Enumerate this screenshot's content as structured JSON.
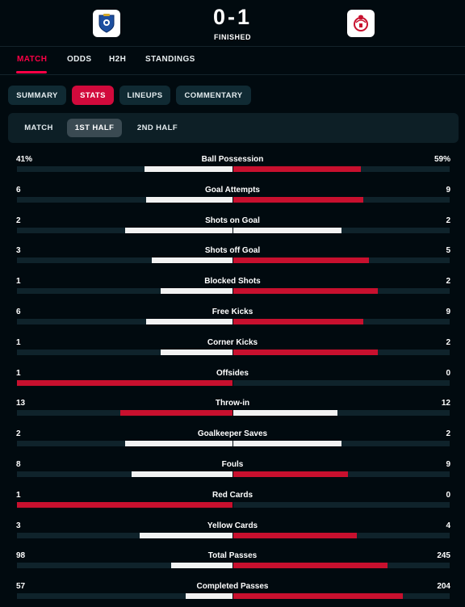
{
  "match": {
    "score": "0-1",
    "status": "FINISHED",
    "home_team_icon": "porto-crest-icon",
    "away_team_icon": "benfica-crest-icon"
  },
  "top_nav": [
    "MATCH",
    "ODDS",
    "H2H",
    "STANDINGS"
  ],
  "sub_tabs": [
    "SUMMARY",
    "STATS",
    "LINEUPS",
    "COMMENTARY"
  ],
  "periods": [
    "MATCH",
    "1ST HALF",
    "2ND HALF"
  ],
  "colors": {
    "accent": "#ff0046",
    "active_pill": "#d20a3c",
    "home_bar": "#f2f2f2",
    "away_bar": "#c8102e",
    "background": "#010a0f"
  },
  "stats": [
    {
      "label": "Ball Possession",
      "home": "41%",
      "away": "59%",
      "home_share": 0.41,
      "away_share": 0.59
    },
    {
      "label": "Goal Attempts",
      "home": "6",
      "away": "9",
      "home_share": 0.4,
      "away_share": 0.6
    },
    {
      "label": "Shots on Goal",
      "home": "2",
      "away": "2",
      "home_share": 0.5,
      "away_share": 0.5
    },
    {
      "label": "Shots off Goal",
      "home": "3",
      "away": "5",
      "home_share": 0.375,
      "away_share": 0.625
    },
    {
      "label": "Blocked Shots",
      "home": "1",
      "away": "2",
      "home_share": 0.333,
      "away_share": 0.667
    },
    {
      "label": "Free Kicks",
      "home": "6",
      "away": "9",
      "home_share": 0.4,
      "away_share": 0.6
    },
    {
      "label": "Corner Kicks",
      "home": "1",
      "away": "2",
      "home_share": 0.333,
      "away_share": 0.667
    },
    {
      "label": "Offsides",
      "home": "1",
      "away": "0",
      "home_share": 1.0,
      "away_share": 0.0
    },
    {
      "label": "Throw-in",
      "home": "13",
      "away": "12",
      "home_share": 0.52,
      "away_share": 0.48
    },
    {
      "label": "Goalkeeper Saves",
      "home": "2",
      "away": "2",
      "home_share": 0.5,
      "away_share": 0.5
    },
    {
      "label": "Fouls",
      "home": "8",
      "away": "9",
      "home_share": 0.47,
      "away_share": 0.53
    },
    {
      "label": "Red Cards",
      "home": "1",
      "away": "0",
      "home_share": 1.0,
      "away_share": 0.0
    },
    {
      "label": "Yellow Cards",
      "home": "3",
      "away": "4",
      "home_share": 0.429,
      "away_share": 0.571
    },
    {
      "label": "Total Passes",
      "home": "98",
      "away": "245",
      "home_share": 0.286,
      "away_share": 0.714
    },
    {
      "label": "Completed Passes",
      "home": "57",
      "away": "204",
      "home_share": 0.218,
      "away_share": 0.782
    }
  ]
}
